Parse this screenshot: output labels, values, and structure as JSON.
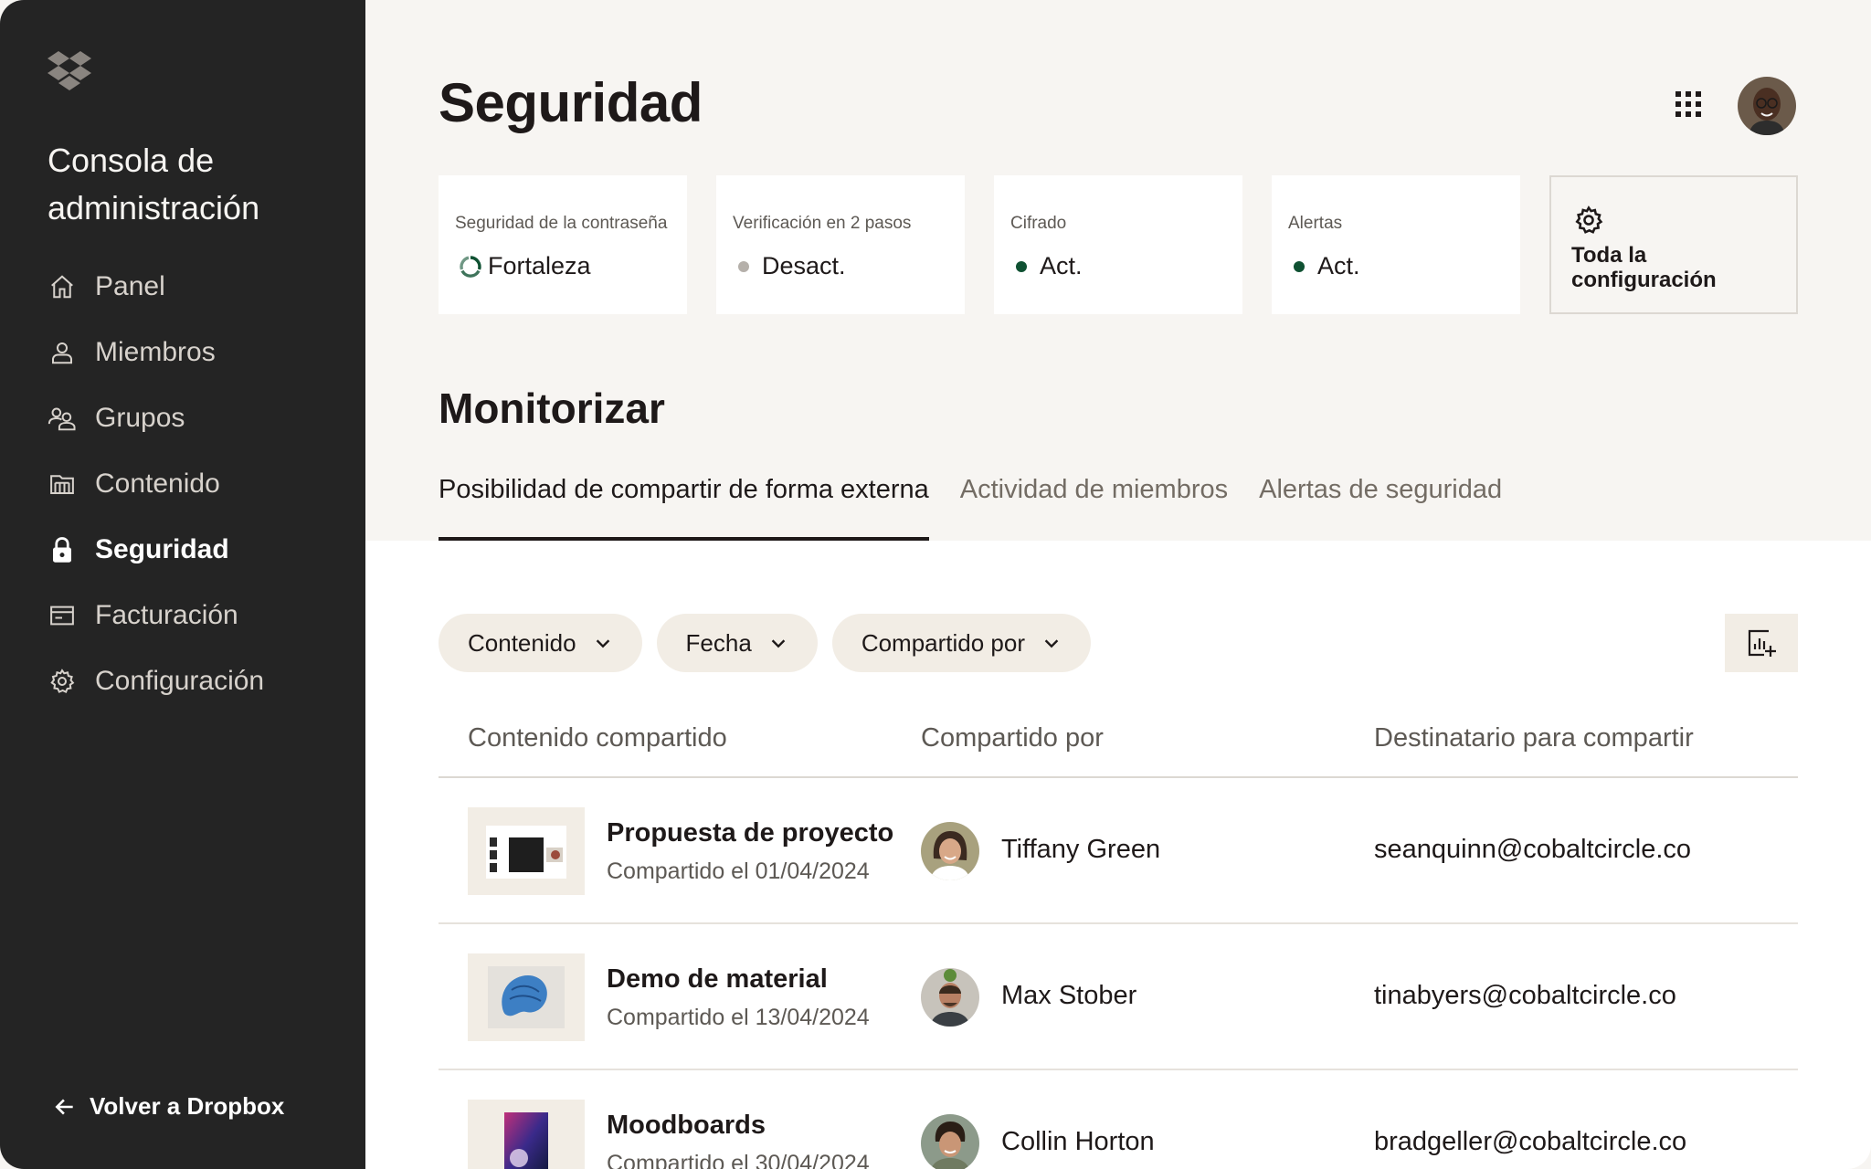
{
  "sidebar": {
    "console_title": "Consola de administración",
    "items": [
      {
        "label": "Panel",
        "icon": "home-icon"
      },
      {
        "label": "Miembros",
        "icon": "person-icon"
      },
      {
        "label": "Grupos",
        "icon": "group-icon"
      },
      {
        "label": "Contenido",
        "icon": "folder-icon"
      },
      {
        "label": "Seguridad",
        "icon": "lock-icon",
        "active": true
      },
      {
        "label": "Facturación",
        "icon": "billing-icon"
      },
      {
        "label": "Configuración",
        "icon": "gear-icon"
      }
    ],
    "back_link": "Volver a Dropbox"
  },
  "header": {
    "title": "Seguridad"
  },
  "cards": [
    {
      "label": "Seguridad de la contraseña",
      "value": "Fortaleza",
      "indicator": "strength-ring-icon"
    },
    {
      "label": "Verificación en 2 pasos",
      "value": "Desact.",
      "status_color": "#b5b0aa"
    },
    {
      "label": "Cifrado",
      "value": "Act.",
      "status_color": "#0f5132"
    },
    {
      "label": "Alertas",
      "value": "Act.",
      "status_color": "#0f5132"
    }
  ],
  "config_card": {
    "label": "Toda la configuración"
  },
  "monitor": {
    "title": "Monitorizar",
    "tabs": [
      {
        "label": "Posibilidad de compartir de forma externa",
        "active": true
      },
      {
        "label": "Actividad de miembros"
      },
      {
        "label": "Alertas de seguridad"
      }
    ],
    "filters": [
      "Contenido",
      "Fecha",
      "Compartido por"
    ],
    "table": {
      "columns": [
        "Contenido compartido",
        "Compartido por",
        "Destinatario para compartir"
      ],
      "rows": [
        {
          "title": "Propuesta de proyecto",
          "date": "Compartido el 01/04/2024",
          "shared_by": "Tiffany Green",
          "recipient": "seanquinn@cobaltcircle.co"
        },
        {
          "title": "Demo de material",
          "date": "Compartido el 13/04/2024",
          "shared_by": "Max Stober",
          "recipient": "tinabyers@cobaltcircle.co"
        },
        {
          "title": "Moodboards",
          "date": "Compartido el 30/04/2024",
          "shared_by": "Collin Horton",
          "recipient": "bradgeller@cobaltcircle.co"
        }
      ]
    }
  },
  "colors": {
    "sidebar_bg": "#242424",
    "page_bg": "#f7f5f2",
    "chip_bg": "#f2ede5",
    "status_on": "#0f5132",
    "status_off": "#b5b0aa"
  }
}
